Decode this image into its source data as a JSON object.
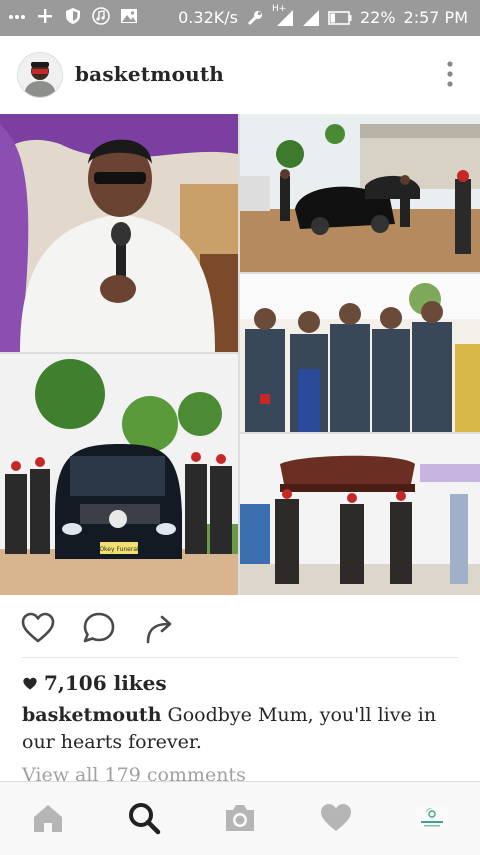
{
  "status_bar": {
    "speed": "0.32K/s",
    "signal_label": "H+",
    "battery": "22%",
    "time": "2:57 PM",
    "icons": [
      "more-dots-icon",
      "plus-icon",
      "shield-icon",
      "music-icon",
      "image-icon",
      "wrench-icon",
      "signal-icon",
      "signal-icon",
      "battery-icon"
    ]
  },
  "post": {
    "username": "basketmouth",
    "likes": "7,106 likes",
    "caption_user": "basketmouth",
    "caption_text": " Goodbye Mum, you'll live in our hearts forever.",
    "comments_link": "View all 179 comments",
    "hearse_plate": "Okey Funeral"
  },
  "actions": [
    "like-icon",
    "comment-icon",
    "share-icon"
  ],
  "bottom_nav": [
    "home-icon",
    "search-icon",
    "camera-icon",
    "activity-icon",
    "profile-icon"
  ],
  "colors": {
    "status_bar": "#9a9a9a",
    "text": "#262626",
    "muted": "#a0a0a0",
    "nav_bg": "#f8f8f8"
  }
}
